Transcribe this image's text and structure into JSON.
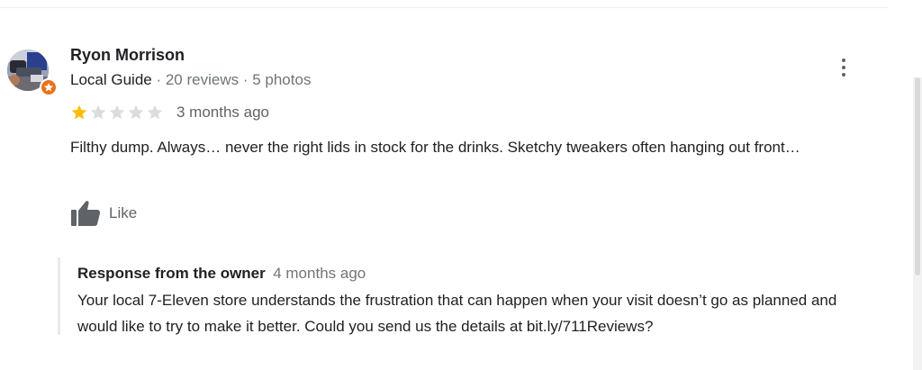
{
  "review": {
    "author": {
      "name": "Ryon Morrison",
      "badge": "Local Guide",
      "reviews": "20 reviews",
      "photos": "5 photos",
      "separator": " · "
    },
    "rating": {
      "value": 1,
      "max": 5,
      "filled_color": "#fbbc04",
      "empty_color": "#dadce0"
    },
    "time": "3 months ago",
    "text": "Filthy dump. Always… never the right lids in stock for the drinks. Sketchy tweakers often hanging out front…",
    "actions": {
      "like_label": "Like",
      "like_icon": "thumbs-up-icon",
      "more_icon": "more-vert-icon"
    },
    "owner_response": {
      "title": "Response from the owner",
      "time": "4 months ago",
      "text": "Your local 7-Eleven store understands the frustration that can happen when your visit doesn’t go as planned and would like to try to make it better. Could you send us the details at bit.ly/711Reviews?"
    }
  },
  "colors": {
    "local_guide_badge": "#e8711a",
    "text_primary": "#202124",
    "text_secondary": "#5f6368"
  }
}
